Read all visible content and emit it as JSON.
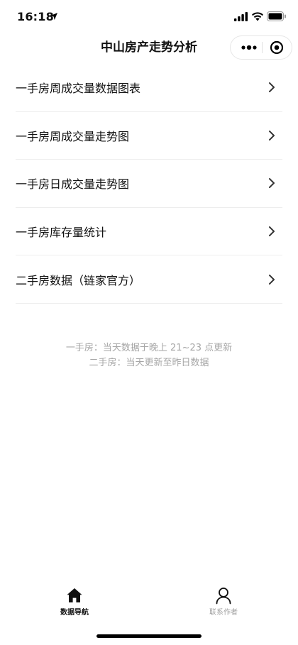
{
  "status_bar": {
    "time": "16:18",
    "icons": [
      "location-arrow-icon",
      "signal-icon",
      "wifi-icon",
      "battery-icon"
    ]
  },
  "nav": {
    "title": "中山房产走势分析",
    "capsule_icons": [
      "more-dots-icon",
      "close-target-icon"
    ]
  },
  "menu": {
    "items": [
      {
        "label": "一手房周成交量数据图表"
      },
      {
        "label": "一手房周成交量走势图"
      },
      {
        "label": "一手房日成交量走势图"
      },
      {
        "label": "一手房库存量统计"
      },
      {
        "label": "二手房数据（链家官方）"
      }
    ]
  },
  "notes": {
    "line1": "一手房：当天数据于晚上 21~23 点更新",
    "line2": "二手房：当天更新至昨日数据"
  },
  "tab_bar": {
    "tabs": [
      {
        "label": "数据导航",
        "icon": "home-icon",
        "active": true
      },
      {
        "label": "联系作者",
        "icon": "person-icon",
        "active": false
      }
    ]
  },
  "colors": {
    "text_primary": "#111111",
    "text_muted": "#a6a6a6",
    "divider": "#ededed",
    "tab_inactive": "#a0a0a0"
  }
}
